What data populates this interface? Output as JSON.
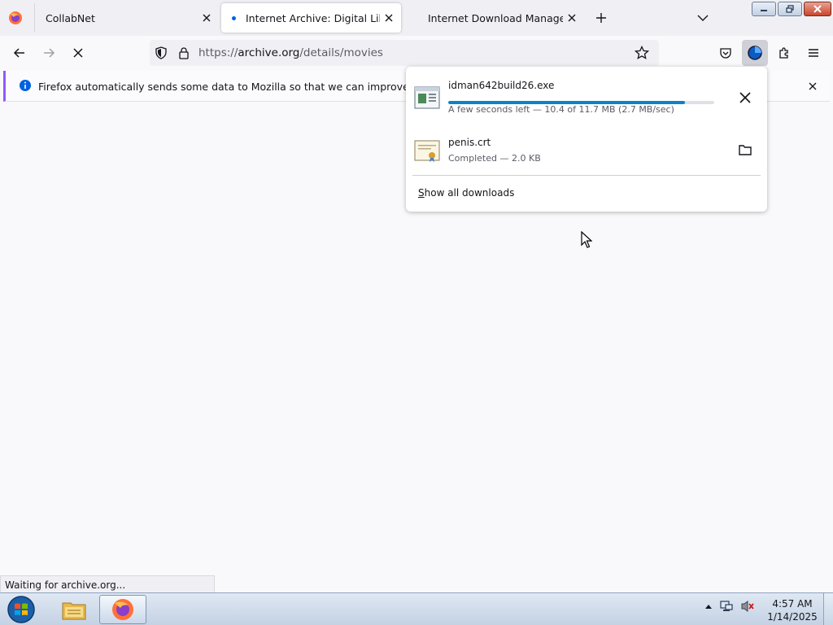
{
  "tabs": [
    {
      "title": "CollabNet"
    },
    {
      "title": "Internet Archive: Digital Library",
      "active": true
    },
    {
      "title": "Internet Download Manager is a"
    }
  ],
  "urlbar": {
    "prefix": "https://",
    "host": "archive.org",
    "path": "/details/movies"
  },
  "notification": {
    "text": "Firefox automatically sends some data to Mozilla so that we can improve your experien"
  },
  "downloads": {
    "items": [
      {
        "name": "idman642build26.exe",
        "status": "A few seconds left — 10.4 of 11.7 MB (2.7 MB/sec)",
        "progress": 0.89
      },
      {
        "name": "penis.crt",
        "status": "Completed — 2.0 KB"
      }
    ],
    "show_all_label_accesskey": "S",
    "show_all_label_rest": "how all downloads"
  },
  "status_text": "Waiting for archive.org...",
  "clock": {
    "time": "4:57 AM",
    "date": "1/14/2025"
  },
  "colors": {
    "accent": "#0a84c6",
    "notification_border": "#9059ff"
  }
}
